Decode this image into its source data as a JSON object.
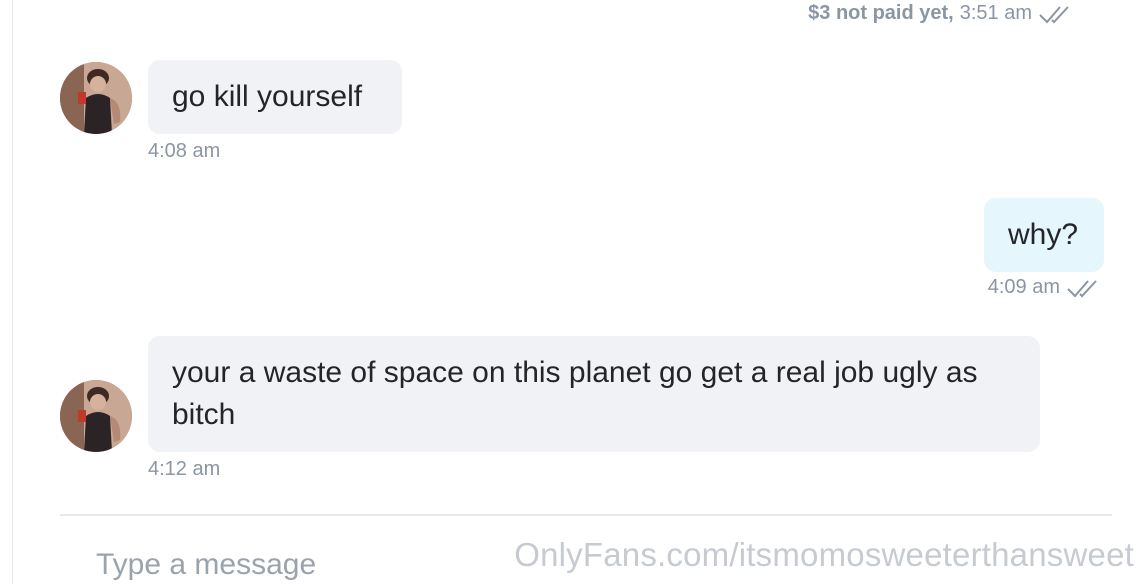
{
  "conversation": {
    "previous_status": {
      "payment_label": "$3 not paid yet,",
      "time": "3:51 am"
    },
    "messages": [
      {
        "sender": "other",
        "text": "go kill yourself",
        "time": "4:08 am"
      },
      {
        "sender": "me",
        "text": "why?",
        "time": "4:09 am"
      },
      {
        "sender": "other",
        "text": "your a waste of space on this planet go get a real job ugly as bitch",
        "time": "4:12 am"
      }
    ]
  },
  "composer": {
    "placeholder": "Type a message"
  },
  "watermark": "OnlyFans.com/itsmomosweeterthansweet",
  "icons": {
    "read_receipt": "double-check-icon",
    "avatar": "user-avatar-photo"
  },
  "colors": {
    "incoming_bubble": "#f1f2f5",
    "outgoing_bubble": "#e6f6fd",
    "meta_text": "#8a96a3"
  }
}
